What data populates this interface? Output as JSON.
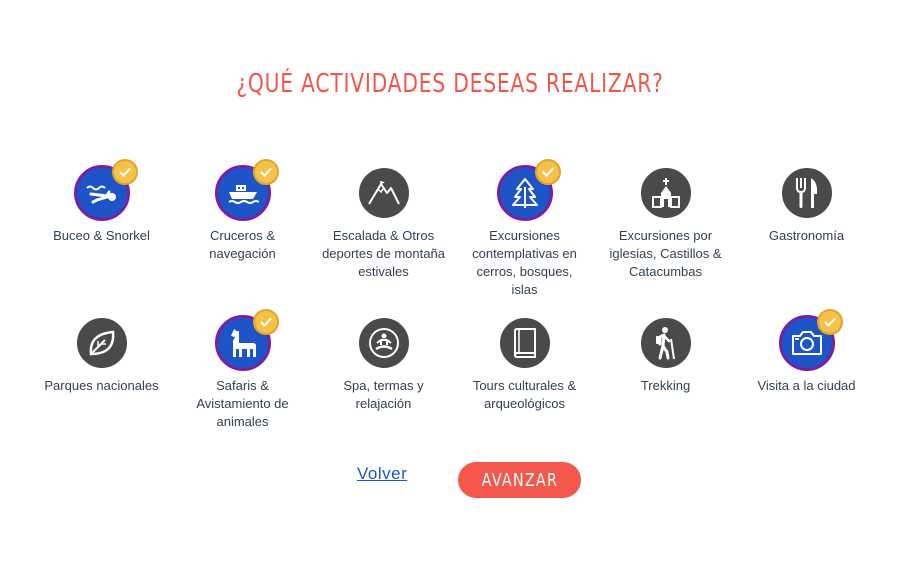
{
  "page": {
    "title": "¿QUÉ ACTIVIDADES DESEAS REALIZAR?"
  },
  "colors": {
    "title": "#f0574a",
    "icon_default": "#4a4a4a",
    "icon_selected": "#1d55c8",
    "selected_ring": "#7b1fa2",
    "check_badge": "#f4c14a",
    "button": "#f4584d",
    "link": "#1a56c7"
  },
  "activities": [
    {
      "label": "Buceo & Snorkel",
      "icon": "diver-icon",
      "selected": true
    },
    {
      "label": "Cruceros &\nnavegación",
      "icon": "ship-icon",
      "selected": true
    },
    {
      "label": "Escalada & Otros\ndeportes de montaña\nestivales",
      "icon": "mountain-icon",
      "selected": false
    },
    {
      "label": "Excursiones\ncontemplativas en\ncerros, bosques,\nislas",
      "icon": "pine-tree-icon",
      "selected": true
    },
    {
      "label": "Excursiones por\niglesias, Castillos &\nCatacumbas",
      "icon": "church-icon",
      "selected": false
    },
    {
      "label": "Gastronomía",
      "icon": "fork-knife-icon",
      "selected": false
    },
    {
      "label": "Parques nacionales",
      "icon": "leaf-icon",
      "selected": false
    },
    {
      "label": "Safaris &\nAvistamiento de\nanimales",
      "icon": "llama-icon",
      "selected": true
    },
    {
      "label": "Spa, termas y\nrelajación",
      "icon": "meditation-icon",
      "selected": false
    },
    {
      "label": "Tours culturales &\narqueológicos",
      "icon": "book-icon",
      "selected": false
    },
    {
      "label": "Trekking",
      "icon": "hiker-icon",
      "selected": false
    },
    {
      "label": "Visita a la ciudad",
      "icon": "camera-icon",
      "selected": true
    }
  ],
  "actions": {
    "back_label": "Volver",
    "next_label": "AVANZAR"
  }
}
